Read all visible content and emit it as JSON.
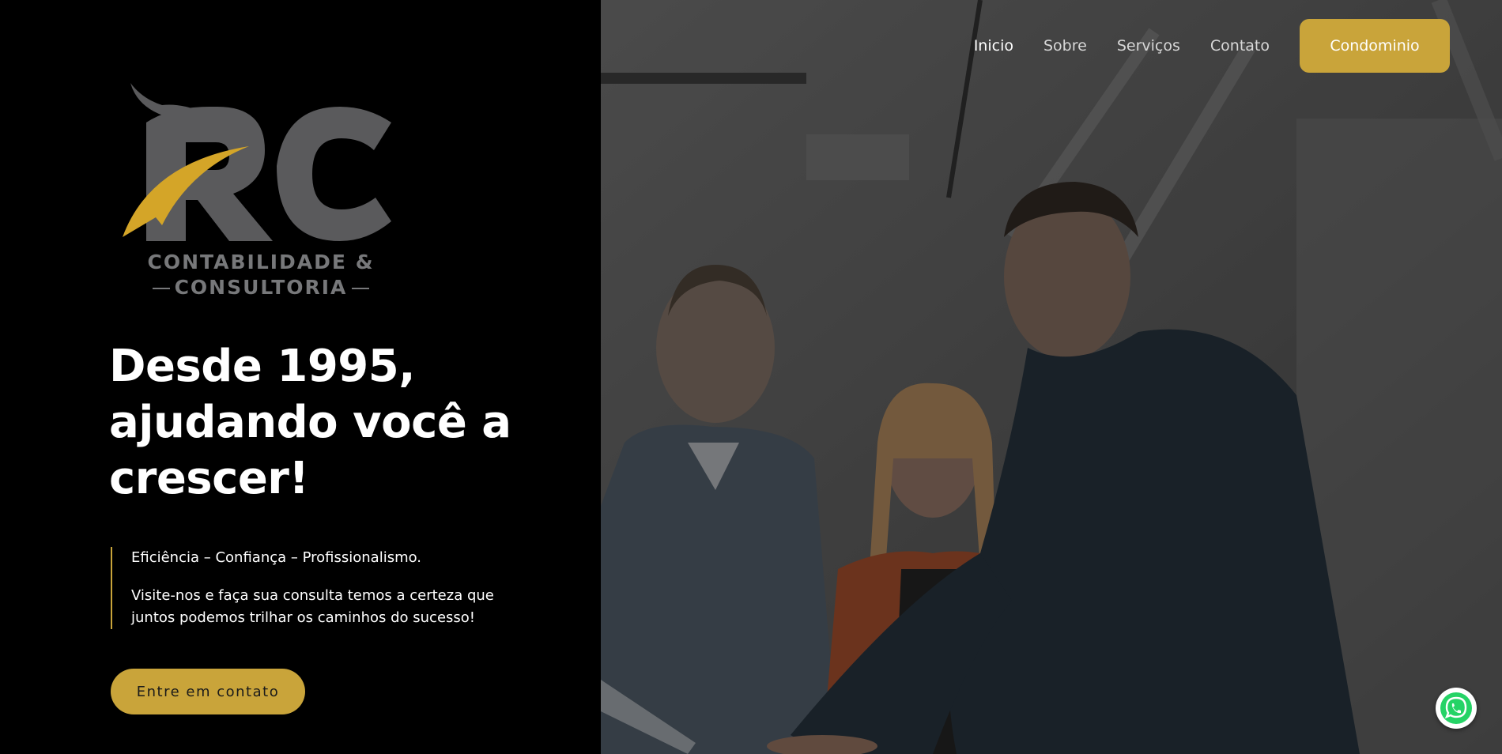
{
  "brand": {
    "logo_line1": "CONTABILIDADE &",
    "logo_line2": "CONSULTORIA",
    "gold": "#c9a43a",
    "gray": "#5a5a5c"
  },
  "nav": {
    "items": [
      {
        "label": "Inicio",
        "active": true
      },
      {
        "label": "Sobre",
        "active": false
      },
      {
        "label": "Serviços",
        "active": false
      },
      {
        "label": "Contato",
        "active": false
      }
    ],
    "button_label": "Condominio"
  },
  "hero": {
    "headline_line1": "Desde 1995,",
    "headline_line2": "ajudando você a",
    "headline_line3": "crescer!",
    "tagline": "Eficiência – Confiança – Profissionalismo.",
    "description_line1": "Visite-nos e faça sua consulta temos a certeza que",
    "description_line2": "juntos podemos trilhar os caminhos do sucesso!",
    "cta_label": "Entre em contato"
  },
  "icons": {
    "whatsapp": "whatsapp-icon"
  }
}
